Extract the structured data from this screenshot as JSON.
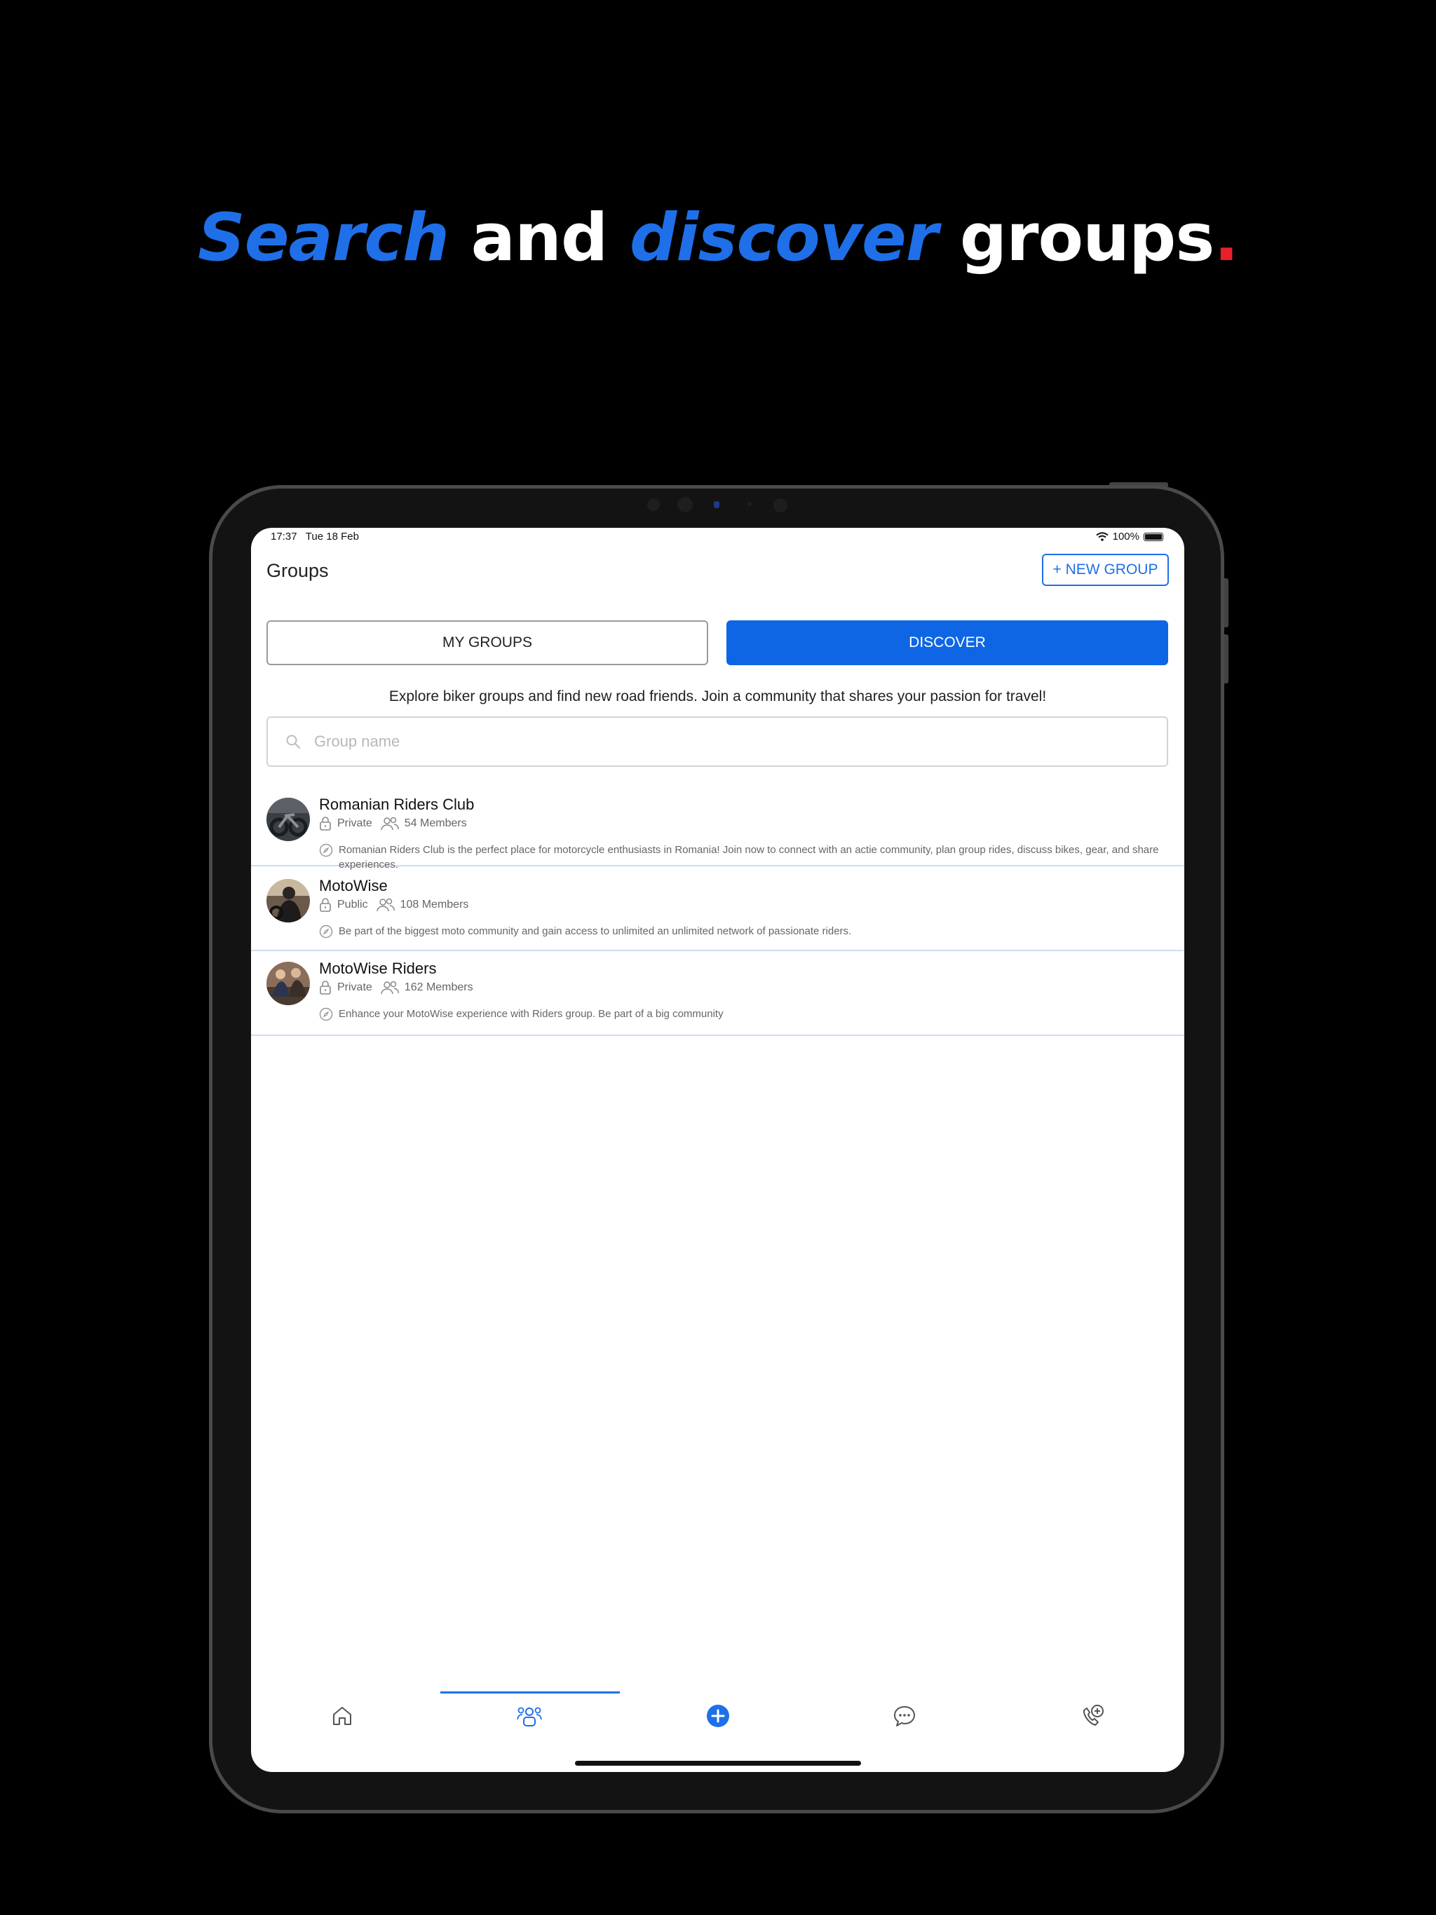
{
  "headline": {
    "word1": "Search",
    "word2": "and",
    "word3": "discover",
    "word4": "groups",
    "dot": "."
  },
  "status_bar": {
    "time": "17:37",
    "date": "Tue 18 Feb",
    "battery": "100%"
  },
  "header": {
    "title": "Groups",
    "new_group_label": "+ NEW GROUP"
  },
  "tabs": [
    {
      "label": "MY GROUPS",
      "active": false
    },
    {
      "label": "DISCOVER",
      "active": true
    }
  ],
  "explore_text": "Explore biker groups and find new road friends. Join a community that shares your passion for travel!",
  "search": {
    "placeholder": "Group name",
    "value": ""
  },
  "groups": [
    {
      "name": "Romanian Riders Club",
      "privacy": "Private",
      "members": "54 Members",
      "description": "Romanian Riders Club is the perfect place for motorcycle enthusiasts in Romania! Join now to connect with an actie community, plan group rides, discuss bikes, gear, and share experiences."
    },
    {
      "name": "MotoWise",
      "privacy": "Public",
      "members": "108 Members",
      "description": "Be part of the biggest moto community and gain access to unlimited an unlimited network of passionate riders."
    },
    {
      "name": "MotoWise Riders",
      "privacy": "Private",
      "members": "162 Members",
      "description": "Enhance your MotoWise experience with Riders group. Be part of a big community"
    }
  ],
  "bottom_nav": [
    {
      "icon": "home-icon",
      "active": false
    },
    {
      "icon": "groups-icon",
      "active": true
    },
    {
      "icon": "add-circle-icon",
      "active": false
    },
    {
      "icon": "chat-icon",
      "active": false
    },
    {
      "icon": "emergency-call-icon",
      "active": false
    }
  ],
  "colors": {
    "accent": "#1f6fe8",
    "discover_tab": "#0e66e4",
    "headline_dot": "#e8202a",
    "background": "#000000"
  }
}
